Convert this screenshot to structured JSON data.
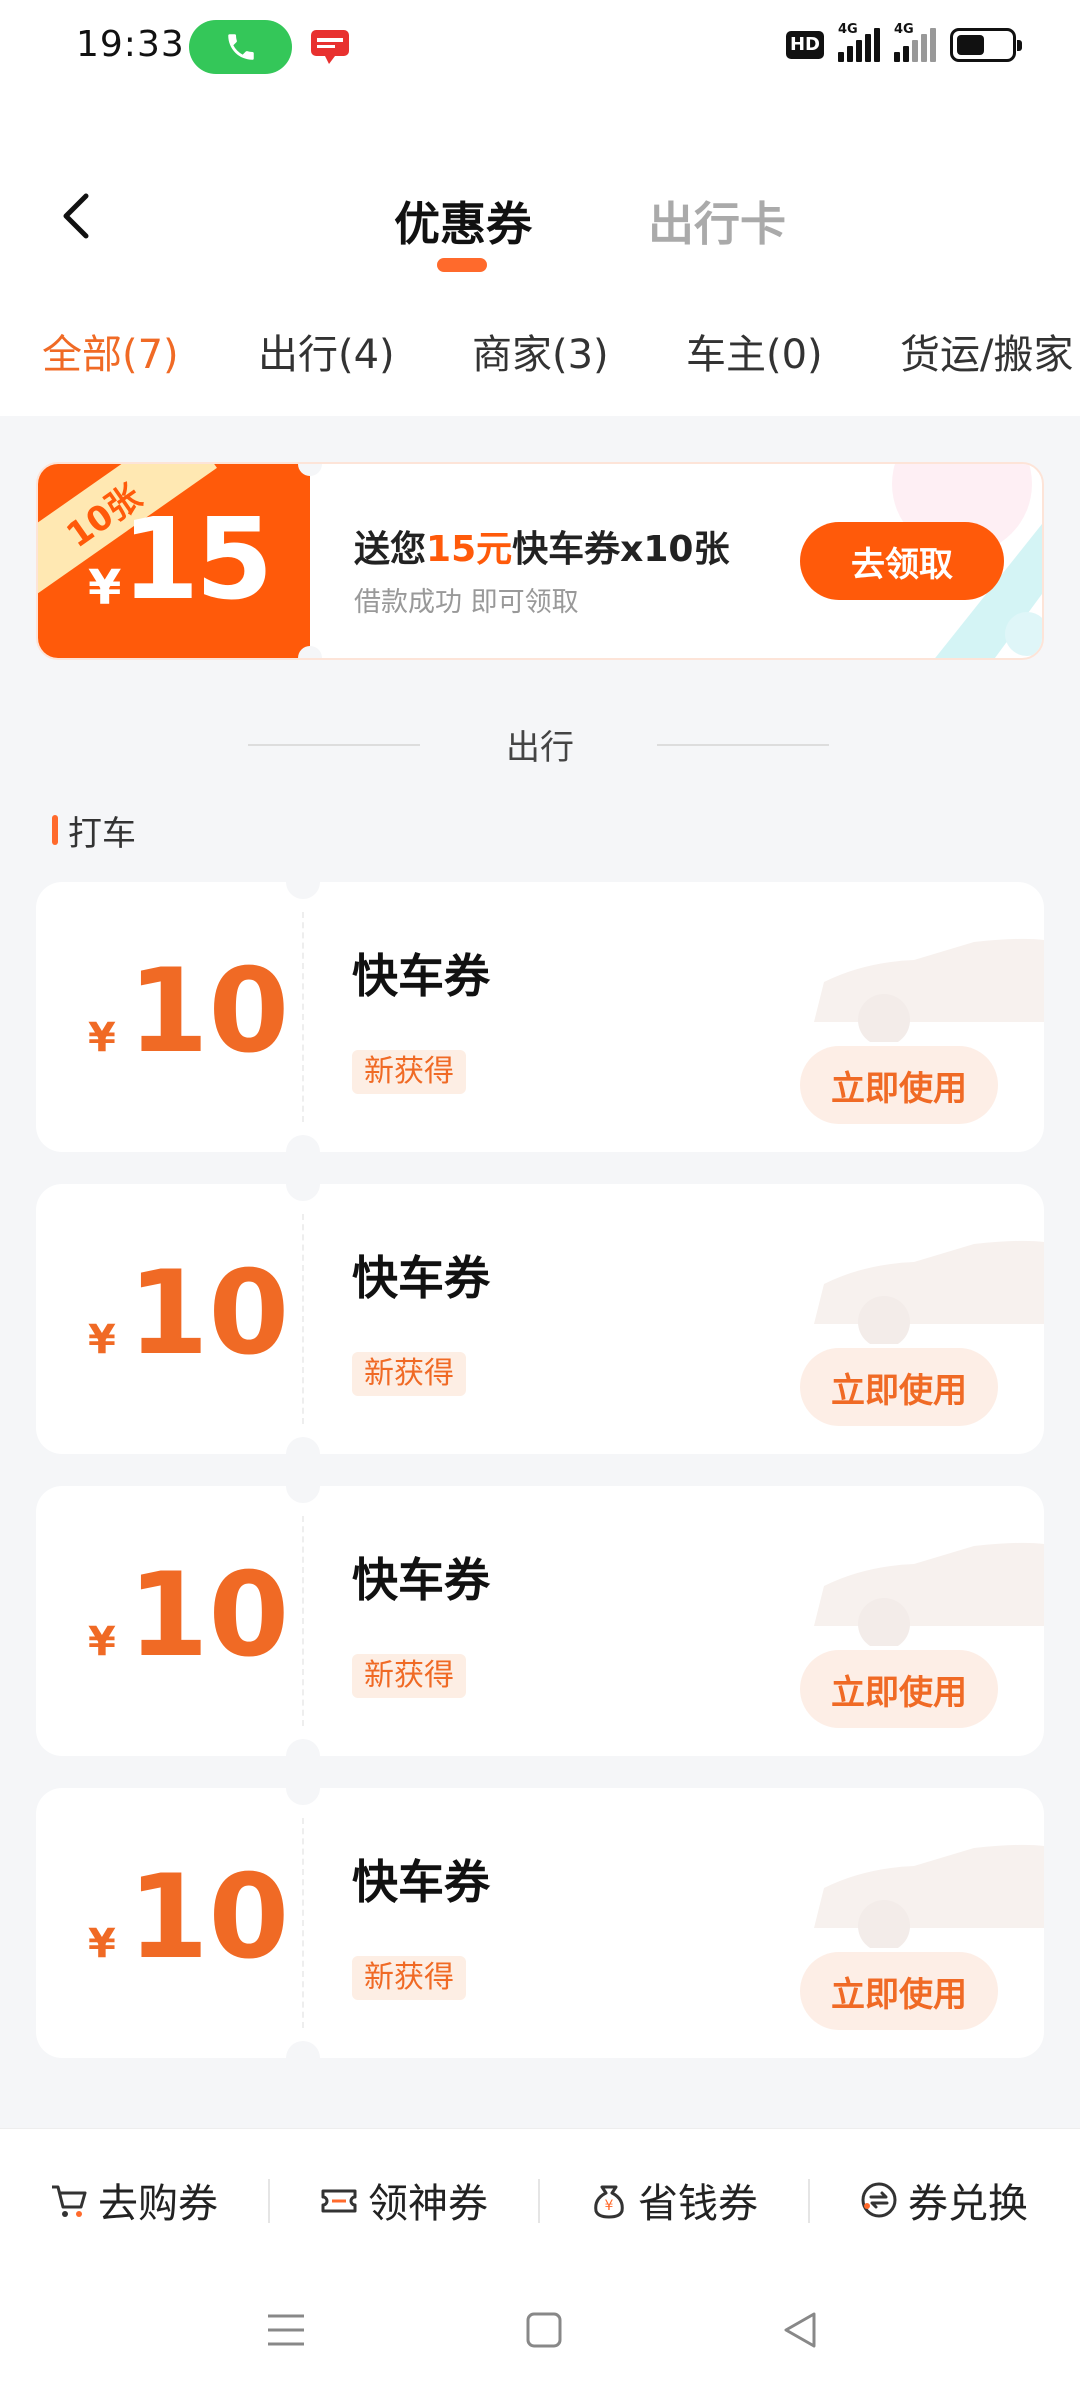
{
  "status_bar": {
    "time": "19:33",
    "network_1": "4G",
    "network_2": "4G",
    "hd": "HD",
    "app_badge": "云闪付"
  },
  "header": {
    "tabs": [
      {
        "label": "优惠券",
        "active": true
      },
      {
        "label": "出行卡",
        "active": false
      }
    ],
    "filters": [
      {
        "label": "全部(7)",
        "active": true
      },
      {
        "label": "出行(4)",
        "active": false
      },
      {
        "label": "商家(3)",
        "active": false
      },
      {
        "label": "车主(0)",
        "active": false
      },
      {
        "label": "货运/搬家",
        "active": false
      }
    ]
  },
  "promo": {
    "ribbon": "10张",
    "currency": "¥",
    "amount": "15",
    "title_pre": "送您",
    "title_highlight": "15元",
    "title_post": "快车券x10张",
    "subtitle": "借款成功 即可领取",
    "button": "去领取"
  },
  "section": {
    "title": "出行",
    "category": "打车"
  },
  "coupons": [
    {
      "currency": "¥",
      "amount": "10",
      "name": "快车券",
      "tag": "新获得",
      "button": "立即使用"
    },
    {
      "currency": "¥",
      "amount": "10",
      "name": "快车券",
      "tag": "新获得",
      "button": "立即使用"
    },
    {
      "currency": "¥",
      "amount": "10",
      "name": "快车券",
      "tag": "新获得",
      "button": "立即使用"
    },
    {
      "currency": "¥",
      "amount": "10",
      "name": "快车券",
      "tag": "新获得",
      "button": "立即使用"
    }
  ],
  "bottom_nav": [
    {
      "label": "去购券",
      "icon": "cart-icon"
    },
    {
      "label": "领神券",
      "icon": "ticket-icon"
    },
    {
      "label": "省钱券",
      "icon": "money-bag-icon"
    },
    {
      "label": "券兑换",
      "icon": "exchange-icon"
    }
  ],
  "colors": {
    "accent": "#ff5a0a",
    "accent_text": "#f06a25",
    "page_bg": "#f5f6f8"
  }
}
